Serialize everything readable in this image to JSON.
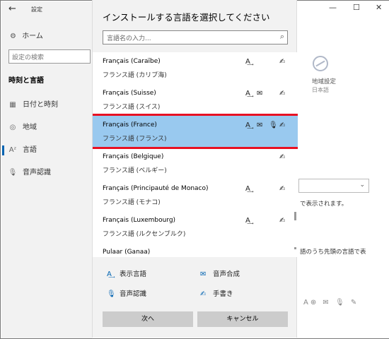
{
  "app": {
    "title": "設定",
    "back_glyph": "←",
    "window_controls": [
      "—",
      "☐",
      "✕"
    ]
  },
  "sidebar": {
    "home_label": "ホーム",
    "search_placeholder": "設定の検索",
    "section_title": "時刻と言語",
    "items": [
      {
        "label": "日付と時刻",
        "icon": "calendar-icon",
        "glyph": "▦"
      },
      {
        "label": "地域",
        "icon": "globe-icon",
        "glyph": "◎"
      },
      {
        "label": "言語",
        "icon": "language-icon",
        "glyph": "Aᶻ"
      },
      {
        "label": "音声認識",
        "icon": "microphone-icon",
        "glyph": "🎙"
      }
    ]
  },
  "background": {
    "region_label": "地域設定",
    "region_sub": "日本語",
    "text_fragment_1": "で表示されます。",
    "text_fragment_2": "語のうち先頭の言語で表",
    "feature_icons": "A⊕ ✉ 🎙 ✎"
  },
  "dialog": {
    "title": "インストールする言語を選択してください",
    "search_placeholder": "言語名の入力...",
    "languages": [
      {
        "name": "Français (Caraïbe)",
        "sub": "フランス語 (カリブ海)",
        "features": [
          "display",
          "handwriting"
        ],
        "selected": false
      },
      {
        "name": "Français (Suisse)",
        "sub": "フランス語 (スイス)",
        "features": [
          "display",
          "tts",
          "handwriting"
        ],
        "selected": false
      },
      {
        "name": "Français (France)",
        "sub": "フランス語 (フランス)",
        "features": [
          "display",
          "tts",
          "speech",
          "handwriting"
        ],
        "selected": true
      },
      {
        "name": "Français (Belgique)",
        "sub": "フランス語 (ベルギー)",
        "features": [
          "display",
          "handwriting"
        ],
        "selected": false
      },
      {
        "name": "Français (Principauté de Monaco)",
        "sub": "フランス語 (モナコ)",
        "features": [
          "display",
          "handwriting"
        ],
        "selected": false
      },
      {
        "name": "Français (Luxembourg)",
        "sub": "フランス語 (ルクセンブルク)",
        "features": [
          "display",
          "handwriting"
        ],
        "selected": false
      },
      {
        "name": "Pulaar (Ganaa)",
        "sub": "",
        "features": [],
        "selected": false
      }
    ],
    "legend": {
      "display": "表示言語",
      "tts": "音声合成",
      "speech": "音声認識",
      "handwriting": "手書き"
    },
    "buttons": {
      "next": "次へ",
      "cancel": "キャンセル"
    },
    "selection_highlight_color": "#99c9ef",
    "callout_color": "#e81123"
  }
}
